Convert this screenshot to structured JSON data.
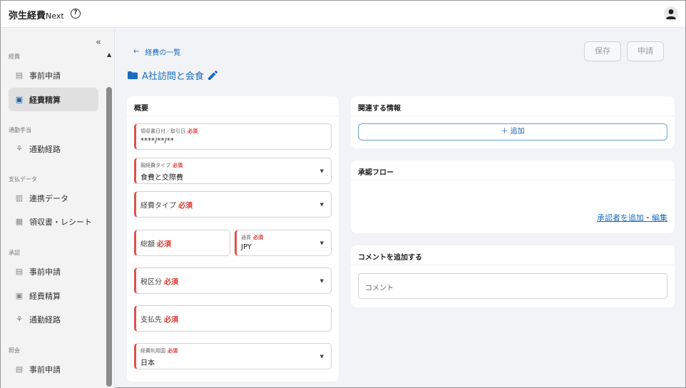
{
  "header": {
    "app_title": "弥生経費",
    "app_title_suffix": "Next",
    "help_icon": "question-circle-icon",
    "avatar_icon": "user-avatar-icon"
  },
  "sidebar": {
    "collapse_icon": "double-chevron-left-icon",
    "sections": [
      {
        "label": "経費",
        "items": [
          {
            "label": "事前申請",
            "icon": "document-icon",
            "active": false
          },
          {
            "label": "経費精算",
            "icon": "receipt-icon",
            "active": true
          }
        ]
      },
      {
        "label": "通勤手当",
        "items": [
          {
            "label": "通勤経路",
            "icon": "walking-icon",
            "active": false
          }
        ]
      },
      {
        "label": "支払データ",
        "items": [
          {
            "label": "連携データ",
            "icon": "data-icon",
            "active": false
          },
          {
            "label": "領収書・レシート",
            "icon": "receipt-paper-icon",
            "active": false
          }
        ]
      },
      {
        "label": "承認",
        "items": [
          {
            "label": "事前申請",
            "icon": "approve-document-icon",
            "active": false
          },
          {
            "label": "経費精算",
            "icon": "approve-receipt-icon",
            "active": false
          },
          {
            "label": "通勤経路",
            "icon": "approve-route-icon",
            "active": false
          }
        ]
      },
      {
        "label": "照会",
        "items": [
          {
            "label": "事前申請",
            "icon": "search-document-icon",
            "active": false
          }
        ]
      }
    ]
  },
  "main": {
    "back_label": "経費の一覧",
    "title": "A社訪問と会食",
    "save_label": "保存",
    "apply_label": "申請",
    "required_tag": "必須",
    "summary": {
      "title": "概要",
      "receipt_date": {
        "label": "領収書日付／取引日",
        "value": "****/**/**"
      },
      "parent_expense_type": {
        "label": "親経費タイプ",
        "value": "食費と交際費"
      },
      "expense_type": {
        "label": "経費タイプ"
      },
      "total": {
        "label": "総額"
      },
      "currency": {
        "label": "通貨",
        "value": "JPY"
      },
      "tax_category": {
        "label": "税区分"
      },
      "payee": {
        "label": "支払先"
      },
      "country": {
        "label": "経費利用国",
        "value": "日本"
      }
    },
    "related": {
      "title": "関連する情報",
      "add_label": "＋ 追加"
    },
    "approval": {
      "title": "承認フロー",
      "link_label": "承認者を追加・編集"
    },
    "comment": {
      "title": "コメントを追加する",
      "placeholder": "コメント"
    }
  }
}
